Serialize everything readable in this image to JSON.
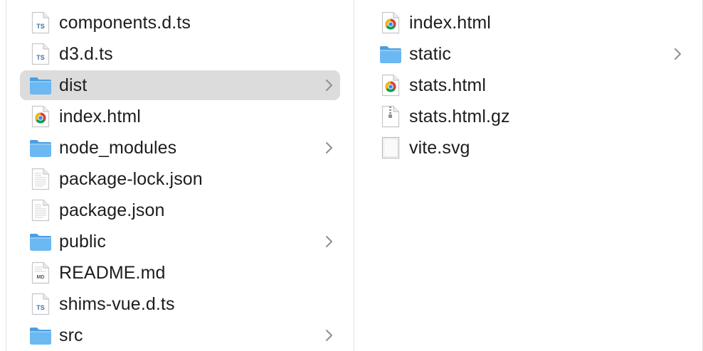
{
  "columns": [
    {
      "items": [
        {
          "name": "components.d.ts",
          "icon": "typescript-file-icon",
          "badge": "TS",
          "has_children": false,
          "selected": false
        },
        {
          "name": "d3.d.ts",
          "icon": "typescript-file-icon",
          "badge": "TS",
          "has_children": false,
          "selected": false
        },
        {
          "name": "dist",
          "icon": "folder-icon",
          "has_children": true,
          "selected": true
        },
        {
          "name": "index.html",
          "icon": "chrome-html-file-icon",
          "has_children": false,
          "selected": false
        },
        {
          "name": "node_modules",
          "icon": "folder-icon",
          "has_children": true,
          "selected": false
        },
        {
          "name": "package-lock.json",
          "icon": "text-document-icon",
          "has_children": false,
          "selected": false
        },
        {
          "name": "package.json",
          "icon": "text-document-icon",
          "has_children": false,
          "selected": false
        },
        {
          "name": "public",
          "icon": "folder-icon",
          "has_children": true,
          "selected": false
        },
        {
          "name": "README.md",
          "icon": "markdown-file-icon",
          "badge": "MD",
          "has_children": false,
          "selected": false
        },
        {
          "name": "shims-vue.d.ts",
          "icon": "typescript-file-icon",
          "badge": "TS",
          "has_children": false,
          "selected": false
        },
        {
          "name": "src",
          "icon": "folder-icon",
          "has_children": true,
          "selected": false
        }
      ]
    },
    {
      "items": [
        {
          "name": "index.html",
          "icon": "chrome-html-file-icon",
          "has_children": false,
          "selected": false
        },
        {
          "name": "static",
          "icon": "folder-icon",
          "has_children": true,
          "selected": false
        },
        {
          "name": "stats.html",
          "icon": "chrome-html-file-icon",
          "has_children": false,
          "selected": false
        },
        {
          "name": "stats.html.gz",
          "icon": "zip-archive-icon",
          "has_children": false,
          "selected": false
        },
        {
          "name": "vite.svg",
          "icon": "svg-document-icon",
          "has_children": false,
          "selected": false
        }
      ]
    }
  ],
  "colors": {
    "selection": "#dcdcdc",
    "folder": "#6cb8f2",
    "folder_tab": "#4a9fe3",
    "chevron": "#8e8e93",
    "text": "#1d1d1f"
  }
}
